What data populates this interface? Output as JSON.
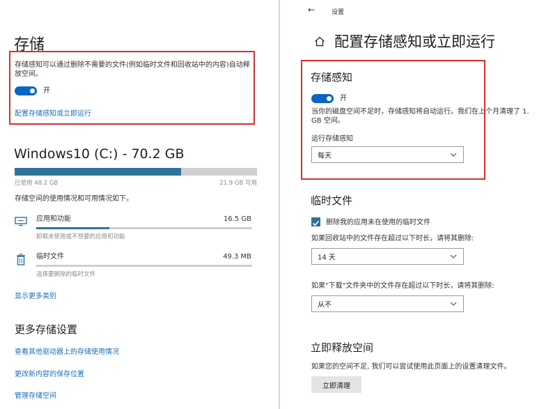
{
  "left": {
    "title": "存储",
    "sense_desc": "存储感知可以通过删除不需要的文件(例如临时文件和回收站中的内容)自动释放空间。",
    "toggle_label": "开",
    "configure_link": "配置存储感知或立即运行",
    "drive_title": "Windows10 (C:) - 70.2 GB",
    "usage_fraction": 0.687,
    "used_label": "已使用 48.2 GB",
    "free_label": "21.9 GB 可用",
    "usage_desc": "存储空间的使用情况和可用情况如下。",
    "categories": [
      {
        "name": "应用和功能",
        "size": "16.5 GB",
        "desc": "卸载未使用或不想要的应用和功能",
        "fraction": 0.34,
        "icon": "apps-icon"
      },
      {
        "name": "临时文件",
        "size": "49.3 MB",
        "desc": "选择要删除的临时文件",
        "fraction": 0.0,
        "icon": "trash-icon"
      }
    ],
    "show_more": "显示更多类别",
    "more_title": "更多存储设置",
    "links": [
      "查看其他驱动器上的存储使用情况",
      "更改新内容的保存位置",
      "管理存储空间"
    ]
  },
  "right": {
    "back": "←",
    "breadcrumb": "设置",
    "page_title": "配置存储感知或立即运行",
    "sense_title": "存储感知",
    "toggle_label": "开",
    "sense_desc": "当你的磁盘空间不足时，存储感知将自动运行。我们在上个月清理了 1.",
    "sense_desc2": "GB 空间。",
    "run_label": "运行存储感知",
    "run_value": "每天",
    "temp_title": "临时文件",
    "temp_checkbox": "删除我的应用未在使用的临时文件",
    "recycle_label": "如果回收站中的文件存在超过以下时长，请将其删除:",
    "recycle_value": "14 天",
    "downloads_label": "如果\"下载\"文件夹中的文件存在超过以下时长，请将其删除:",
    "downloads_value": "从不",
    "free_title": "立即释放空间",
    "free_desc": "如果您的空间不足, 我们可以尝试使用此页面上的设置清理文件。",
    "free_button": "立即清理"
  },
  "colors": {
    "accent": "#2e7399",
    "toggle": "#0a66c2",
    "link": "#1a6fb5",
    "highlight": "#d32f2f"
  }
}
